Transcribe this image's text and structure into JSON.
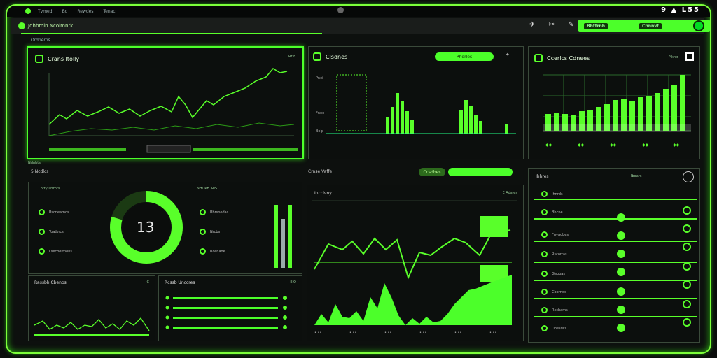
{
  "topbar": {
    "menus": [
      "Tvmed",
      "Bo",
      "Rewdes",
      "Tenac"
    ],
    "tray": "9 ▲ L55"
  },
  "navbar": {
    "brand": "Jdhbmin Ncolmnrk",
    "tools": "✈ ✂ ✎",
    "cta_pill": "Bhttrnh",
    "cta_right": "Cbnnvt"
  },
  "subhead": "Ordnerns",
  "panel1": {
    "title": "Crans Itolly",
    "corner": "Rr F",
    "ymin": "-"
  },
  "panel2": {
    "title": "Clsdnes",
    "button": "Phdrles",
    "axis": [
      "Pnei",
      "Fnoo",
      "Bolp"
    ]
  },
  "panel3": {
    "title": "Ccerlcs Cdnees",
    "corner": "Plkrer"
  },
  "section_left": "Ndnbts",
  "section_mid": "Crnse Vaffe",
  "section_mid_button": "Ccsdbes",
  "ring_panel": {
    "header_left": "Lorry Lrrmrs",
    "header_right": "NHOPB IRIS",
    "value": "13",
    "items": [
      "Bscneamos",
      "Toatbrcs",
      "Lsecoormons"
    ],
    "items_right": [
      "Bbrsnedas",
      "Nrcbs",
      "Rcenaoe"
    ]
  },
  "line_panel": {
    "title": "Incclvny",
    "corner": "E Adsres"
  },
  "list_panel": {
    "title": "Ihhres",
    "header_right": "Iboars",
    "rows": [
      "Ihnrds",
      "Bhcne",
      "Fnvaobes",
      "Rscorras",
      "Gabbas",
      "Cbbrnds",
      "Rccbams",
      "Doesdcs"
    ]
  },
  "bottom_left": {
    "title": "Rassbh Cbenos",
    "corner": "C"
  },
  "bottom_mid": {
    "title": "Rcssb Unccres",
    "corner": "E O"
  },
  "colors": {
    "accent": "#4cff2a",
    "bg": "#0b0d0c"
  }
}
